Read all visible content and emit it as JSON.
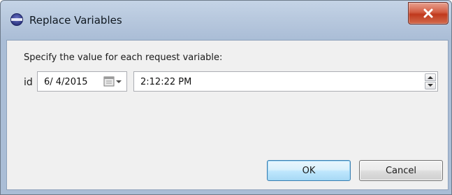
{
  "window": {
    "title": "Replace Variables"
  },
  "dialog": {
    "prompt": "Specify the value for each request variable:",
    "variables": [
      {
        "name": "id",
        "date": "6/ 4/2015",
        "time": "2:12:22 PM"
      }
    ]
  },
  "buttons": {
    "ok": "OK",
    "cancel": "Cancel"
  },
  "icons": {
    "title": "app-icon",
    "close": "close-icon",
    "calendar": "calendar-dropdown-icon",
    "spin_up": "spin-up-icon",
    "spin_down": "spin-down-icon"
  },
  "colors": {
    "ok_border": "#3c7fb1",
    "close_red": "#c0391d",
    "title_bg": "#b6c7dd",
    "client_bg": "#f0f0f0"
  }
}
